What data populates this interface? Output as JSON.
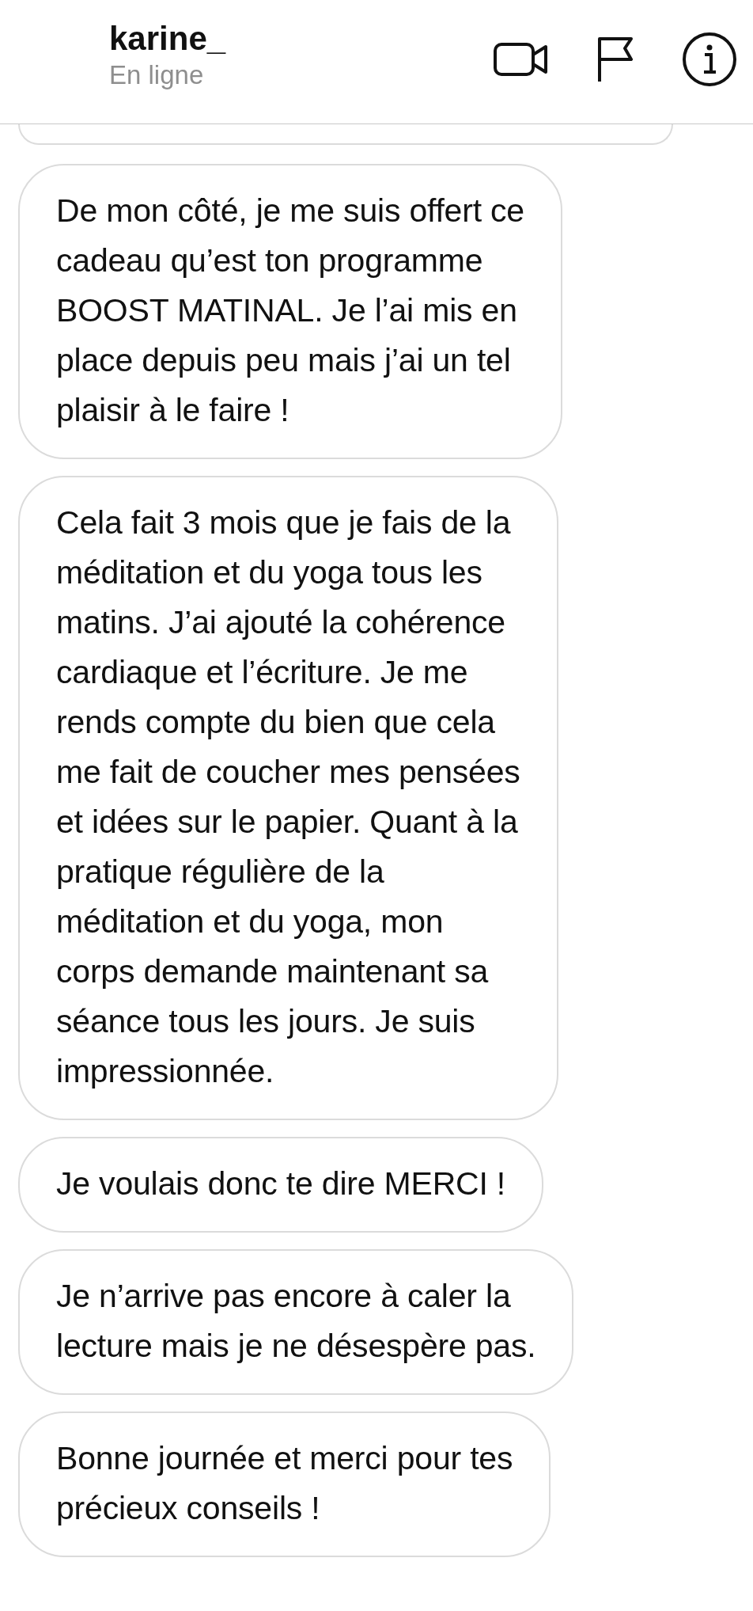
{
  "header": {
    "name": "karine_",
    "status": "En ligne"
  },
  "messages": [
    {
      "text": "De mon côté, je me suis offert ce\ncadeau qu’est ton programme\nBOOST MATINAL. Je l’ai mis en\nplace depuis peu mais j’ai un tel\nplaisir à le faire !"
    },
    {
      "text": "Cela fait 3 mois que je fais de la\nméditation et du yoga tous les\nmatins. J’ai ajouté la cohérence\ncardiaque et l’écriture. Je me\nrends compte du bien que cela\nme fait de coucher mes pensées\net idées sur le papier. Quant à la\npratique régulière de la\nméditation et du yoga, mon\ncorps demande maintenant sa\nséance tous les jours. Je suis\nimpressionnée."
    },
    {
      "text": "Je voulais donc te dire MERCI !"
    },
    {
      "text": "Je n’arrive pas encore à caler la\nlecture mais je ne désespère pas."
    },
    {
      "text": "Bonne journée et merci pour tes\nprécieux conseils !"
    }
  ]
}
